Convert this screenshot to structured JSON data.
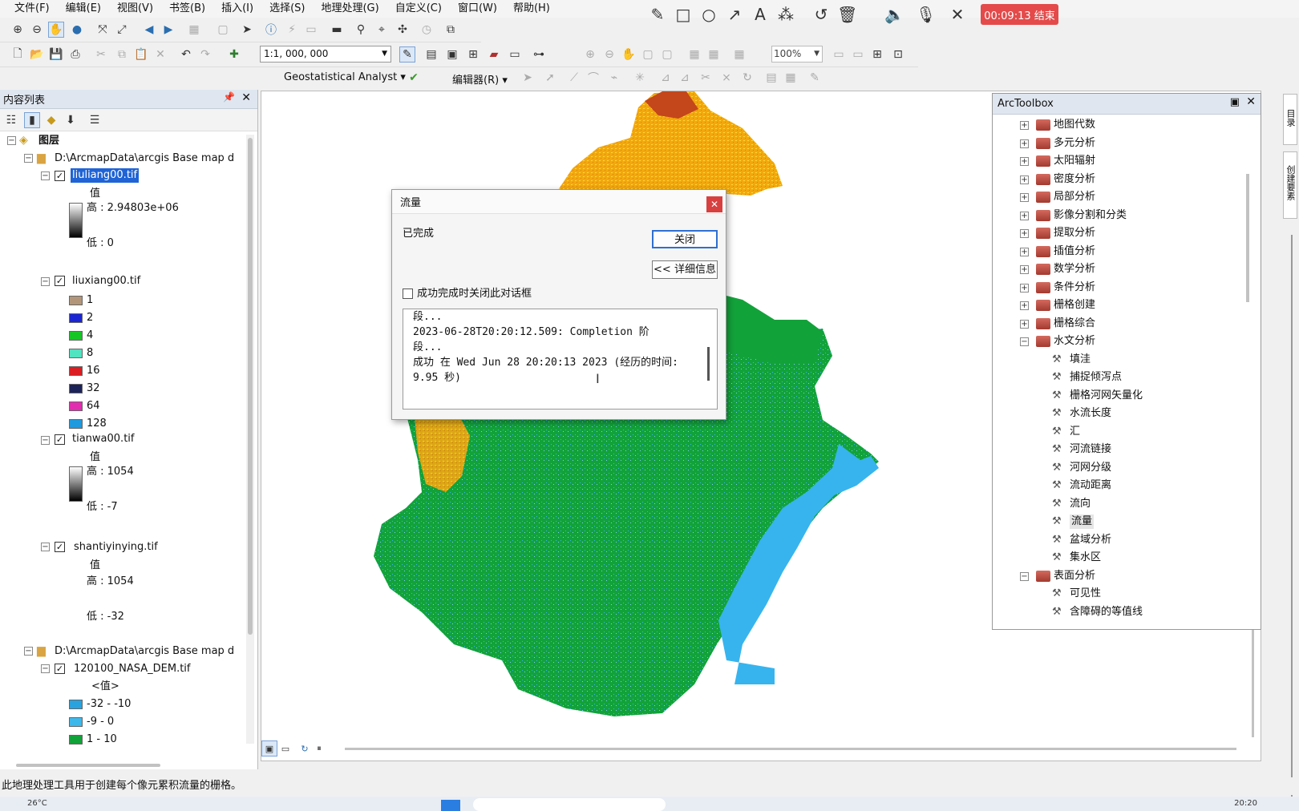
{
  "menu": [
    "文件(F)",
    "编辑(E)",
    "视图(V)",
    "书签(B)",
    "插入(I)",
    "选择(S)",
    "地理处理(G)",
    "自定义(C)",
    "窗口(W)",
    "帮助(H)"
  ],
  "recorder": {
    "timer": "00:09:13 结束"
  },
  "toolbar": {
    "scale": "1:1, 000, 000",
    "zoom": "100%",
    "geostat": "Geostatistical Analyst",
    "editor": "编辑器(R)"
  },
  "toc": {
    "title": "内容列表",
    "root": "图层",
    "groups": [
      {
        "path": "D:\\ArcmapData\\arcgis Base map d"
      },
      {
        "path": "D:\\ArcmapData\\arcgis Base map d"
      }
    ],
    "layers": [
      {
        "name": "liuliang00.tif",
        "value": "值",
        "high": "高 : 2.94803e+06",
        "low": "低 : 0"
      },
      {
        "name": "liuxiang00.tif",
        "classes": [
          {
            "label": "1",
            "color": "#b39679"
          },
          {
            "label": "2",
            "color": "#1b25d3"
          },
          {
            "label": "4",
            "color": "#17c626"
          },
          {
            "label": "8",
            "color": "#52e3c0"
          },
          {
            "label": "16",
            "color": "#dc1d21"
          },
          {
            "label": "32",
            "color": "#1c2359"
          },
          {
            "label": "64",
            "color": "#e32db0"
          },
          {
            "label": "128",
            "color": "#1f9adf"
          }
        ]
      },
      {
        "name": "tianwa00.tif",
        "value": "值",
        "high": "高 : 1054",
        "low": "低 : -7"
      },
      {
        "name": "shantiyinying.tif",
        "value": "值",
        "high": "高 : 1054",
        "low": "低 : -32"
      },
      {
        "name": "120100_NASA_DEM.tif",
        "value": "<值>",
        "classes": [
          {
            "label": "-32 - -10",
            "color": "#29a3e0"
          },
          {
            "label": "-9 - 0",
            "color": "#3db8ea"
          },
          {
            "label": "1 - 10",
            "color": "#12a23a"
          }
        ]
      }
    ]
  },
  "dialog": {
    "title": "流量",
    "status": "已完成",
    "close": "关闭",
    "details": "<< 详细信息",
    "checkbox": "成功完成时关闭此对话框",
    "log": [
      "段...",
      "2023-06-28T20:20:12.509: Completion 阶",
      "段...",
      "成功 在 Wed Jun 28 20:20:13 2023 (经历的时间:",
      "9.95 秒)"
    ]
  },
  "toolbox": {
    "title": "ArcToolbox",
    "items": [
      {
        "label": "地图代数",
        "type": "set",
        "exp": "+"
      },
      {
        "label": "多元分析",
        "type": "set",
        "exp": "+"
      },
      {
        "label": "太阳辐射",
        "type": "set",
        "exp": "+"
      },
      {
        "label": "密度分析",
        "type": "set",
        "exp": "+"
      },
      {
        "label": "局部分析",
        "type": "set",
        "exp": "+"
      },
      {
        "label": "影像分割和分类",
        "type": "set",
        "exp": "+"
      },
      {
        "label": "提取分析",
        "type": "set",
        "exp": "+"
      },
      {
        "label": "插值分析",
        "type": "set",
        "exp": "+"
      },
      {
        "label": "数学分析",
        "type": "set",
        "exp": "+"
      },
      {
        "label": "条件分析",
        "type": "set",
        "exp": "+"
      },
      {
        "label": "栅格创建",
        "type": "set",
        "exp": "+"
      },
      {
        "label": "栅格综合",
        "type": "set",
        "exp": "+"
      },
      {
        "label": "水文分析",
        "type": "set",
        "exp": "−"
      },
      {
        "label": "填洼",
        "type": "tool"
      },
      {
        "label": "捕捉倾泻点",
        "type": "tool"
      },
      {
        "label": "栅格河网矢量化",
        "type": "tool"
      },
      {
        "label": "水流长度",
        "type": "tool"
      },
      {
        "label": "汇",
        "type": "tool"
      },
      {
        "label": "河流链接",
        "type": "tool"
      },
      {
        "label": "河网分级",
        "type": "tool"
      },
      {
        "label": "流动距离",
        "type": "tool"
      },
      {
        "label": "流向",
        "type": "tool"
      },
      {
        "label": "流量",
        "type": "tool",
        "selected": true
      },
      {
        "label": "盆域分析",
        "type": "tool"
      },
      {
        "label": "集水区",
        "type": "tool"
      },
      {
        "label": "表面分析",
        "type": "set",
        "exp": "−"
      },
      {
        "label": "可见性",
        "type": "tool"
      },
      {
        "label": "含障碍的等值线",
        "type": "tool"
      }
    ]
  },
  "side": {
    "tab1": "目录",
    "tab2": "创建要素"
  },
  "status": "此地理处理工具用于创建每个像元累积流量的栅格。",
  "taskbar": {
    "temp": "26°C",
    "time": "20:20"
  }
}
